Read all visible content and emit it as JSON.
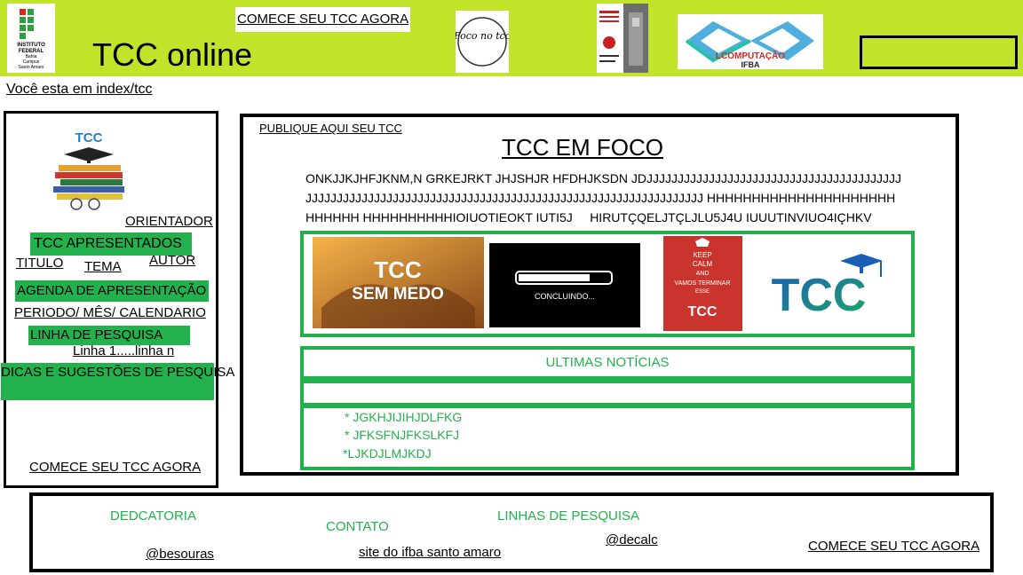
{
  "header": {
    "site_title": "TCC online",
    "top_cta": "COMECE SEU TCC AGORA",
    "ifba_logo_text": [
      "INSTITUTO",
      "FEDERAL",
      "Bahia",
      "Campus",
      "Santo Amaro"
    ],
    "foco_logo_text": "Foco no tcc",
    "lcomp_logo_text": [
      "LCOMPUTAÇÃO",
      "IFBA"
    ],
    "search_value": ""
  },
  "breadcrumb": "Você esta em index/tcc",
  "sidebar": {
    "book_title": "TCC",
    "orientador": "ORIENTADOR",
    "tcc_apresentados": "TCC APRESENTADOS",
    "titulo": "TITULO",
    "tema": "TEMA",
    "autor": "AUTOR",
    "agenda": "AGENDA DE APRESENTAÇÃO",
    "periodo": "PERIODO/ MÊS/ CALENDARIO",
    "linha_pesquisa": "LINHA DE PESQUISA",
    "linhas": "Linha 1.....linha n",
    "dicas": "DICAS  E SUGESTÕES DE PESQUISA",
    "cta": "COMECE SEU TCC AGORA"
  },
  "main": {
    "publique": "PUBLIQUE AQUI SEU TCC",
    "title": "TCC EM FOCO",
    "lorem_lines": [
      "ONKJJKJHFJKNM,N GRKEJRKT JHJSHJR HFDHJKSDN JDJJJJJJJJJJJJJJJJJJJJJJJJJJJJJJJJJJJJJJJJJ",
      "JJJJJJJJJJJJJJJJJJJJJJJJJJJJJJJJJJJJJJJJJJJJJJJJJJJJJJJJJJJJJJJJ HHHHHHHHHHHHHHHHHHHHH",
      "HHHHHH HHHHHHHHHHIOIUOTIEOKT IUTI5J     HIRUTÇQELJTÇLJLU5J4U IUUUTINVIUO4IÇHKV"
    ],
    "images": {
      "sem_medo_top": "TCC",
      "sem_medo_bottom": "SEM MEDO",
      "concluindo": "CONCLUINDO...",
      "keep_calm": [
        "KEEP",
        "CALM",
        "AND",
        "VAMOS TERMINAR",
        "ESSE"
      ],
      "keep_calm_tcc": "TCC",
      "tcc_logo": "TCC"
    },
    "news_title": "ULTIMAS NOTÍCIAS",
    "news_items": [
      "* JGKHJIJIHJDLFKG",
      "* JFKSFNJFKSLKFJ",
      "*LJKDJLMJKDJ"
    ]
  },
  "footer": {
    "dedicatoria": "DEDCATORIA",
    "contato": "CONTATO",
    "linhas_pesquisa": "LINHAS DE PESQUISA",
    "besouras": "@besouras",
    "site_ifba": "site do ifba santo amaro",
    "decalc": "@decalc",
    "cta": "COMECE SEU TCC AGORA"
  },
  "colors": {
    "header_bg": "#c0e42a",
    "accent_green": "#22b14c"
  }
}
